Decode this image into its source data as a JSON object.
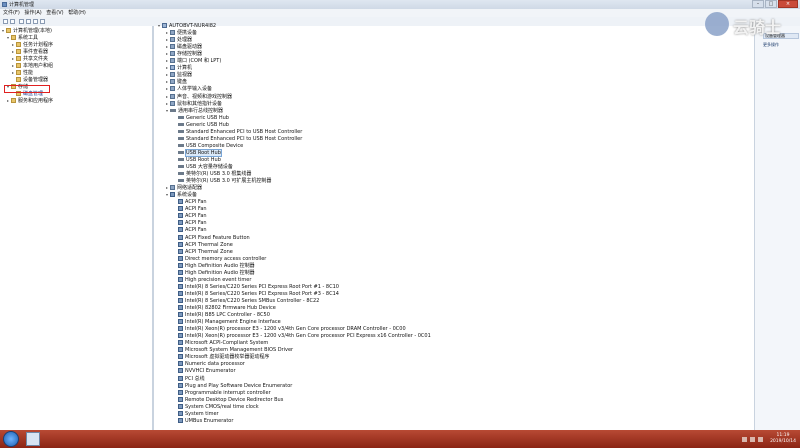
{
  "window": {
    "title": "计算机管理"
  },
  "menubar": [
    "文件(F)",
    "操作(A)",
    "查看(V)",
    "帮助(H)"
  ],
  "left_tree": [
    {
      "label": "计算机管理(本地)",
      "level": 0,
      "expander": "▾"
    },
    {
      "label": "系统工具",
      "level": 1,
      "expander": "▾"
    },
    {
      "label": "任务计划程序",
      "level": 2,
      "expander": "▸"
    },
    {
      "label": "事件查看器",
      "level": 2,
      "expander": "▸"
    },
    {
      "label": "共享文件夹",
      "level": 2,
      "expander": "▸"
    },
    {
      "label": "本地用户和组",
      "level": 2,
      "expander": "▸"
    },
    {
      "label": "性能",
      "level": 2,
      "expander": "▸"
    },
    {
      "label": "设备管理器",
      "level": 2,
      "expander": ""
    },
    {
      "label": "存储",
      "level": 1,
      "expander": "▾"
    },
    {
      "label": "磁盘管理",
      "level": 2,
      "expander": "",
      "highlight": true
    },
    {
      "label": "服务和应用程序",
      "level": 1,
      "expander": "▸"
    }
  ],
  "device_tree": [
    {
      "label": "AUTOBVT-NUR4I82",
      "level": 0,
      "icon": "pc",
      "expander": "▾"
    },
    {
      "label": "便携设备",
      "level": 1,
      "icon": "dev",
      "expander": "▸"
    },
    {
      "label": "处理器",
      "level": 1,
      "icon": "dev",
      "expander": "▸"
    },
    {
      "label": "磁盘驱动器",
      "level": 1,
      "icon": "dev",
      "expander": "▸"
    },
    {
      "label": "存储控制器",
      "level": 1,
      "icon": "dev",
      "expander": "▸"
    },
    {
      "label": "端口 (COM 和 LPT)",
      "level": 1,
      "icon": "dev",
      "expander": "▸"
    },
    {
      "label": "计算机",
      "level": 1,
      "icon": "pc",
      "expander": "▸"
    },
    {
      "label": "监视器",
      "level": 1,
      "icon": "dev",
      "expander": "▸"
    },
    {
      "label": "键盘",
      "level": 1,
      "icon": "dev",
      "expander": "▸"
    },
    {
      "label": "人体学输入设备",
      "level": 1,
      "icon": "dev",
      "expander": "▸"
    },
    {
      "label": "声音、视频和游戏控制器",
      "level": 1,
      "icon": "dev",
      "expander": "▸"
    },
    {
      "label": "鼠标和其他指针设备",
      "level": 1,
      "icon": "dev",
      "expander": "▸"
    },
    {
      "label": "通用串行总线控制器",
      "level": 1,
      "icon": "usb",
      "expander": "▾"
    },
    {
      "label": "Generic USB Hub",
      "level": 2,
      "icon": "usb"
    },
    {
      "label": "Generic USB Hub",
      "level": 2,
      "icon": "usb"
    },
    {
      "label": "Standard Enhanced PCI to USB Host Controller",
      "level": 2,
      "icon": "usb"
    },
    {
      "label": "Standard Enhanced PCI to USB Host Controller",
      "level": 2,
      "icon": "usb"
    },
    {
      "label": "USB Composite Device",
      "level": 2,
      "icon": "usb"
    },
    {
      "label": "USB Root Hub",
      "level": 2,
      "icon": "usb",
      "selected": true
    },
    {
      "label": "USB Root Hub",
      "level": 2,
      "icon": "usb"
    },
    {
      "label": "USB 大容量存储设备",
      "level": 2,
      "icon": "usb"
    },
    {
      "label": "英特尔(R) USB 3.0 根集线器",
      "level": 2,
      "icon": "usb"
    },
    {
      "label": "英特尔(R) USB 3.0 可扩展主机控制器",
      "level": 2,
      "icon": "usb"
    },
    {
      "label": "网络适配器",
      "level": 1,
      "icon": "dev",
      "expander": "▸"
    },
    {
      "label": "系统设备",
      "level": 1,
      "icon": "sys",
      "expander": "▾"
    },
    {
      "label": "ACPI Fan",
      "level": 2,
      "icon": "sys"
    },
    {
      "label": "ACPI Fan",
      "level": 2,
      "icon": "sys"
    },
    {
      "label": "ACPI Fan",
      "level": 2,
      "icon": "sys"
    },
    {
      "label": "ACPI Fan",
      "level": 2,
      "icon": "sys"
    },
    {
      "label": "ACPI Fan",
      "level": 2,
      "icon": "sys"
    },
    {
      "label": "ACPI Fixed Feature Button",
      "level": 2,
      "icon": "sys"
    },
    {
      "label": "ACPI Thermal Zone",
      "level": 2,
      "icon": "sys"
    },
    {
      "label": "ACPI Thermal Zone",
      "level": 2,
      "icon": "sys"
    },
    {
      "label": "Direct memory access controller",
      "level": 2,
      "icon": "sys"
    },
    {
      "label": "High Definition Audio 控制器",
      "level": 2,
      "icon": "sys"
    },
    {
      "label": "High Definition Audio 控制器",
      "level": 2,
      "icon": "sys"
    },
    {
      "label": "High precision event timer",
      "level": 2,
      "icon": "sys"
    },
    {
      "label": "Intel(R) 8 Series/C220 Series PCI Express Root Port #1 - 8C10",
      "level": 2,
      "icon": "sys"
    },
    {
      "label": "Intel(R) 8 Series/C220 Series PCI Express Root Port #3 - 8C14",
      "level": 2,
      "icon": "sys"
    },
    {
      "label": "Intel(R) 8 Series/C220 Series SMBus Controller - 8C22",
      "level": 2,
      "icon": "sys"
    },
    {
      "label": "Intel(R) 82802 Firmware Hub Device",
      "level": 2,
      "icon": "sys"
    },
    {
      "label": "Intel(R) B85 LPC Controller - 8C50",
      "level": 2,
      "icon": "sys"
    },
    {
      "label": "Intel(R) Management Engine Interface",
      "level": 2,
      "icon": "sys"
    },
    {
      "label": "Intel(R) Xeon(R) processor E3 - 1200 v3/4th Gen Core processor DRAM Controller - 0C00",
      "level": 2,
      "icon": "sys"
    },
    {
      "label": "Intel(R) Xeon(R) processor E3 - 1200 v3/4th Gen Core processor PCI Express x16 Controller - 0C01",
      "level": 2,
      "icon": "sys"
    },
    {
      "label": "Microsoft ACPI-Compliant System",
      "level": 2,
      "icon": "sys"
    },
    {
      "label": "Microsoft System Management BIOS Driver",
      "level": 2,
      "icon": "sys"
    },
    {
      "label": "Microsoft 虚拟驱动器枚举器驱动程序",
      "level": 2,
      "icon": "sys"
    },
    {
      "label": "Numeric data processor",
      "level": 2,
      "icon": "sys"
    },
    {
      "label": "NVVHCI Enumerator",
      "level": 2,
      "icon": "sys"
    },
    {
      "label": "PCI 总线",
      "level": 2,
      "icon": "sys"
    },
    {
      "label": "Plug and Play Software Device Enumerator",
      "level": 2,
      "icon": "sys"
    },
    {
      "label": "Programmable interrupt controller",
      "level": 2,
      "icon": "sys"
    },
    {
      "label": "Remote Desktop Device Redirector Bus",
      "level": 2,
      "icon": "sys"
    },
    {
      "label": "System CMOS/real time clock",
      "level": 2,
      "icon": "sys"
    },
    {
      "label": "System timer",
      "level": 2,
      "icon": "sys"
    },
    {
      "label": "UMBus Enumerator",
      "level": 2,
      "icon": "sys"
    }
  ],
  "actions": {
    "header": "操作",
    "item": "设备管理器",
    "more": "更多操作"
  },
  "watermark": {
    "text": "云骑士"
  },
  "taskbar": {
    "time": "11:19",
    "date": "2019/10/14"
  }
}
